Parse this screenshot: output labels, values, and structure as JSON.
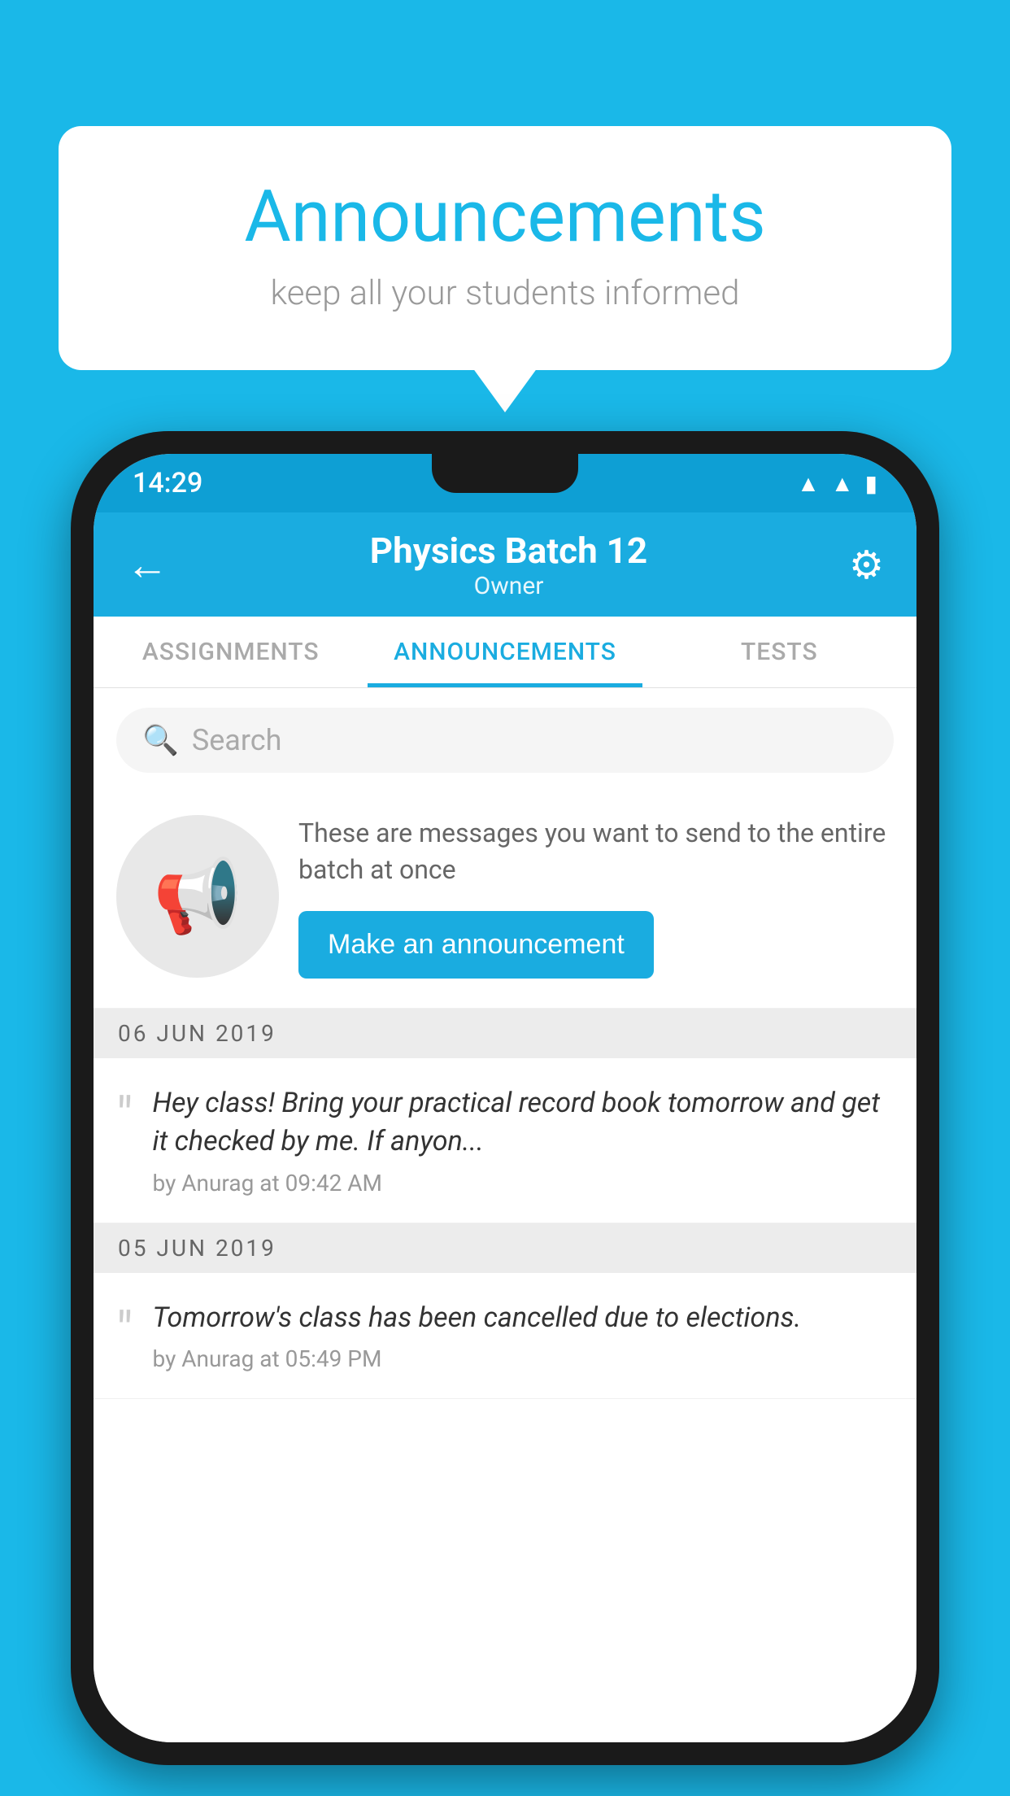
{
  "bubble": {
    "title": "Announcements",
    "subtitle": "keep all your students informed"
  },
  "phone": {
    "statusBar": {
      "time": "14:29",
      "icons": [
        "▲",
        "◀",
        "▮"
      ]
    },
    "appBar": {
      "title": "Physics Batch 12",
      "subtitle": "Owner",
      "backLabel": "←",
      "settingsLabel": "⚙"
    },
    "tabs": [
      {
        "label": "ASSIGNMENTS",
        "active": false
      },
      {
        "label": "ANNOUNCEMENTS",
        "active": true
      },
      {
        "label": "TESTS",
        "active": false
      }
    ],
    "search": {
      "placeholder": "Search"
    },
    "promo": {
      "description": "These are messages you want to send to the entire batch at once",
      "buttonLabel": "Make an announcement"
    },
    "announcements": [
      {
        "date": "06  JUN  2019",
        "text": "Hey class! Bring your practical record book tomorrow and get it checked by me. If anyon...",
        "meta": "by Anurag at 09:42 AM"
      },
      {
        "date": "05  JUN  2019",
        "text": "Tomorrow's class has been cancelled due to elections.",
        "meta": "by Anurag at 05:49 PM"
      }
    ]
  }
}
